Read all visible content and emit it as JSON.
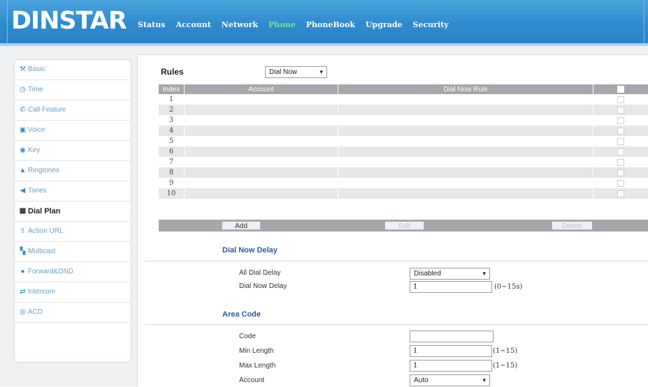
{
  "header": {
    "logo": "DINSTAR",
    "nav": [
      "Status",
      "Account",
      "Network",
      "Phone",
      "PhoneBook",
      "Upgrade",
      "Security"
    ],
    "active_nav": "Phone"
  },
  "sidebar": {
    "items": [
      {
        "label": "Basic",
        "icon": "wrench-icon",
        "glyph": "🔧"
      },
      {
        "label": "Time",
        "icon": "clock-icon",
        "glyph": "◷"
      },
      {
        "label": "Call Feature",
        "icon": "phone-icon",
        "glyph": "✆"
      },
      {
        "label": "Voice",
        "icon": "voice-icon",
        "glyph": "▣"
      },
      {
        "label": "Key",
        "icon": "key-icon",
        "glyph": "◉"
      },
      {
        "label": "Ringtones",
        "icon": "bell-icon",
        "glyph": "▲"
      },
      {
        "label": "Tones",
        "icon": "speaker-icon",
        "glyph": "◀"
      },
      {
        "label": "Dial Plan",
        "icon": "dialplan-icon",
        "glyph": "▦"
      },
      {
        "label": "Action URL",
        "icon": "upload-icon",
        "glyph": "⇧"
      },
      {
        "label": "Multicast",
        "icon": "multicast-icon",
        "glyph": "▚"
      },
      {
        "label": "Forward&DND",
        "icon": "forward-icon",
        "glyph": "●"
      },
      {
        "label": "Intercom",
        "icon": "intercom-icon",
        "glyph": "⇄"
      },
      {
        "label": "ACD",
        "icon": "acd-icon",
        "glyph": "◎"
      }
    ],
    "active": "Dial Plan"
  },
  "rules": {
    "title": "Rules",
    "mode_select": "Dial Now",
    "columns": [
      "Index",
      "Account",
      "Dial Now Rule"
    ],
    "rows": [
      "1",
      "2",
      "3",
      "4",
      "5",
      "6",
      "7",
      "8",
      "9",
      "10"
    ],
    "buttons": {
      "add": "Add",
      "edit": "Edit",
      "delete": "Delete"
    }
  },
  "dial_now_delay": {
    "title": "Dial Now Delay",
    "all_dial_delay_label": "All Dial Delay",
    "all_dial_delay_value": "Disabled",
    "dial_now_delay_label": "Dial Now Delay",
    "dial_now_delay_value": "1",
    "dial_now_delay_hint": "(0~15s)"
  },
  "area_code": {
    "title": "Area Code",
    "code_label": "Code",
    "code_value": "",
    "min_length_label": "Min Length",
    "min_length_value": "1",
    "min_length_hint": "(1~15)",
    "max_length_label": "Max Length",
    "max_length_value": "1",
    "max_length_hint": "(1~15)",
    "account_label": "Account",
    "account_value": "Auto"
  },
  "colors": {
    "header": "#2f8bcf",
    "active_nav": "#7ce38a",
    "section_title": "#2c5aa0",
    "table_header": "#a5a7aa"
  }
}
